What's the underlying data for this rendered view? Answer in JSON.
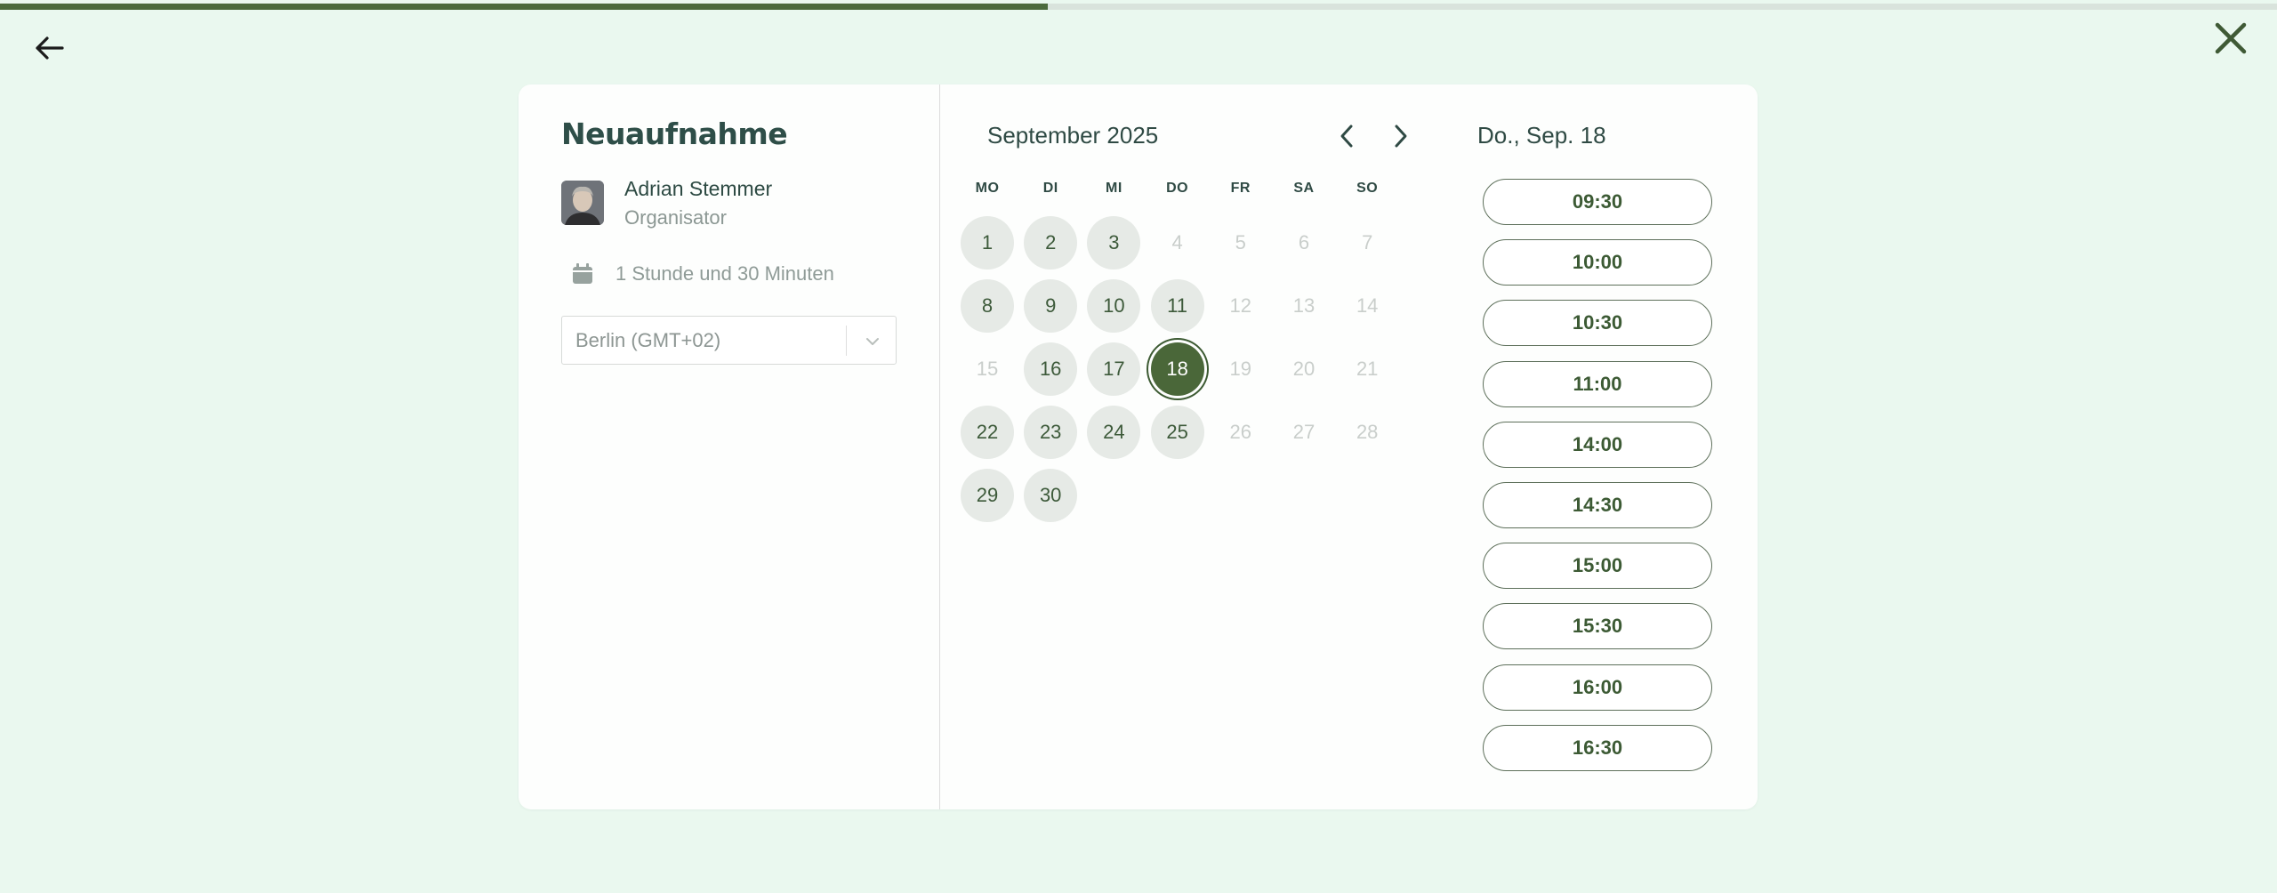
{
  "progress": {
    "fraction": 0.46
  },
  "header": {
    "back_icon": "arrow-left-icon",
    "close_icon": "close-icon"
  },
  "event": {
    "title": "Neuaufnahme",
    "organizer": {
      "name": "Adrian Stemmer",
      "role": "Organisator"
    },
    "duration": "1 Stunde und 30 Minuten",
    "timezone": "Berlin (GMT+02)"
  },
  "calendar": {
    "month_label": "September 2025",
    "weekdays": [
      "MO",
      "DI",
      "MI",
      "DO",
      "FR",
      "SA",
      "SO"
    ],
    "weeks": [
      [
        {
          "d": "1",
          "s": "a"
        },
        {
          "d": "2",
          "s": "a"
        },
        {
          "d": "3",
          "s": "a"
        },
        {
          "d": "4",
          "s": "u"
        },
        {
          "d": "5",
          "s": "u"
        },
        {
          "d": "6",
          "s": "u"
        },
        {
          "d": "7",
          "s": "u"
        }
      ],
      [
        {
          "d": "8",
          "s": "a"
        },
        {
          "d": "9",
          "s": "a"
        },
        {
          "d": "10",
          "s": "a"
        },
        {
          "d": "11",
          "s": "a"
        },
        {
          "d": "12",
          "s": "u"
        },
        {
          "d": "13",
          "s": "u"
        },
        {
          "d": "14",
          "s": "u"
        }
      ],
      [
        {
          "d": "15",
          "s": "u"
        },
        {
          "d": "16",
          "s": "a"
        },
        {
          "d": "17",
          "s": "a"
        },
        {
          "d": "18",
          "s": "sel"
        },
        {
          "d": "19",
          "s": "u"
        },
        {
          "d": "20",
          "s": "u"
        },
        {
          "d": "21",
          "s": "u"
        }
      ],
      [
        {
          "d": "22",
          "s": "a"
        },
        {
          "d": "23",
          "s": "a"
        },
        {
          "d": "24",
          "s": "a"
        },
        {
          "d": "25",
          "s": "a"
        },
        {
          "d": "26",
          "s": "u"
        },
        {
          "d": "27",
          "s": "u"
        },
        {
          "d": "28",
          "s": "u"
        }
      ],
      [
        {
          "d": "29",
          "s": "a"
        },
        {
          "d": "30",
          "s": "a"
        }
      ]
    ]
  },
  "slots": {
    "selected_date": "Do., Sep. 18",
    "times": [
      "09:30",
      "10:00",
      "10:30",
      "11:00",
      "14:00",
      "14:30",
      "15:00",
      "15:30",
      "16:00",
      "16:30"
    ]
  },
  "colors": {
    "accent": "#4a6739",
    "background": "#eaf8ef"
  }
}
